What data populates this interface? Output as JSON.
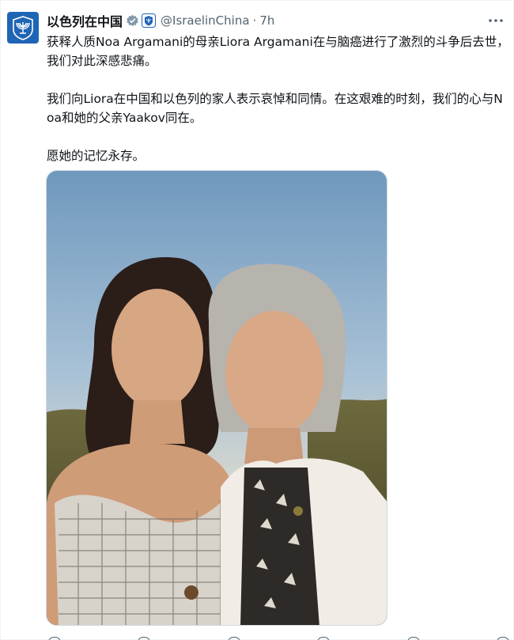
{
  "tweet": {
    "author": {
      "display_name": "以色列在中国",
      "handle": "@IsraelinChina",
      "avatar_icon": "menorah-emblem-icon",
      "verified_icon": "verified-badge-icon",
      "affiliation_icon": "state-emblem-badge-icon"
    },
    "separator": "·",
    "time": "7h",
    "more_icon": "more-options-icon",
    "paragraphs": [
      "获释人质Noa Argamani的母亲Liora Argamani在与脑癌进行了激烈的斗争后去世，我们对此深感悲痛。",
      "我们向Liora在中国和以色列的家人表示哀悼和同情。在这艰难的时刻，我们的心与Noa和她的父亲Yaakov同在。",
      "愿她的记忆永存。"
    ],
    "media": {
      "type": "photo",
      "icon": "photo-two-women-selfie"
    },
    "actions": [
      "reply-icon",
      "retweet-icon",
      "like-icon",
      "views-icon",
      "bookmark-icon",
      "share-icon"
    ]
  },
  "colors": {
    "text_primary": "#0f1419",
    "text_secondary": "#536471",
    "verified_gold": "#e2b719",
    "avatar_blue": "#1f65b5",
    "border": "#cfd9de"
  }
}
